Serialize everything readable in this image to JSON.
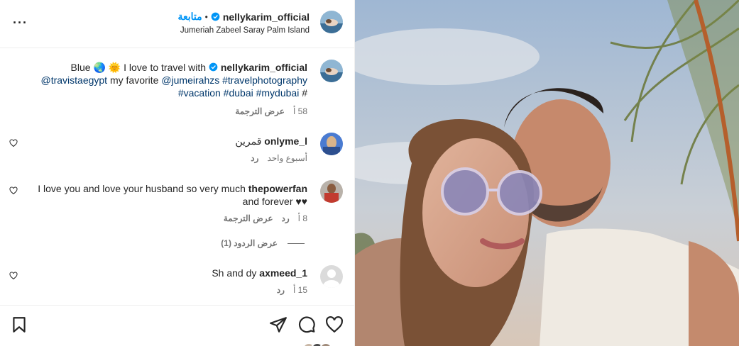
{
  "header": {
    "username": "nellykarim_official",
    "follow_label": "متابعة",
    "dot": "•",
    "location": "Jumeriah Zabeel Saray Palm Island",
    "more_label": "···"
  },
  "caption": {
    "username": "nellykarim_official",
    "text_start": "Blue",
    "emoji_1": "🌏",
    "emoji_2": "🌞",
    "text_mid": "I love to travel with",
    "mention_1": "@travistaegypt",
    "text_fav": "my favorite",
    "mention_2": "@jumeirahzs",
    "tag_1": "#travelphotography",
    "tag_2": "#vacation",
    "tag_3": "#dubai",
    "tag_4": "#mydubai",
    "tag_hash": "#",
    "time": "58 أ",
    "translate": "عرض الترجمة"
  },
  "comments": [
    {
      "username": "onlyme_l",
      "text": "قمرين",
      "time": "أسبوع واحد",
      "reply": "رد"
    },
    {
      "username": "thepowerfan",
      "text_line1": "I love you and love your husband so very much",
      "text_line2": "and forever ♥♥",
      "time": "8 أ",
      "reply": "رد",
      "translate": "عرض الترجمة",
      "view_replies": "عرض الردود (1)"
    },
    {
      "username": "axmeed_1",
      "text": "Sh and dy",
      "time": "15 أ",
      "reply": "رد"
    }
  ],
  "colors": {
    "link": "#00376b",
    "follow": "#0095f6",
    "verified": "#0095f6",
    "meta": "#737373"
  }
}
